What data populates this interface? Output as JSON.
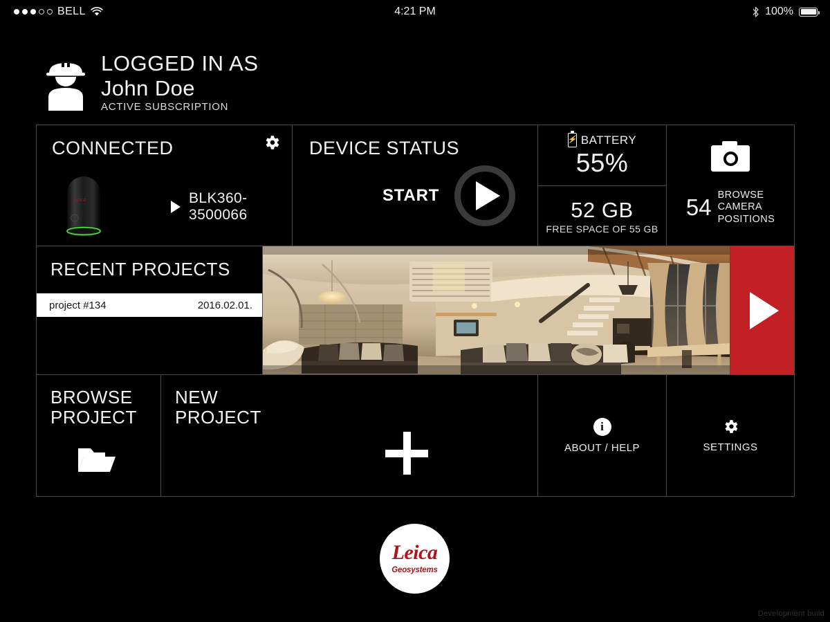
{
  "statusbar": {
    "carrier": "BELL",
    "signal_dots_filled": 3,
    "signal_dots_total": 5,
    "wifi_icon": "wifi-icon",
    "time": "4:21 PM",
    "bluetooth_icon": "bluetooth-icon",
    "battery_percent": "100%",
    "battery_icon": "battery-full-icon"
  },
  "user": {
    "icon": "worker-hardhat-icon",
    "logged_in_label": "LOGGED IN AS",
    "name": "John Doe",
    "subscription": "ACTIVE SUBSCRIPTION"
  },
  "connected": {
    "title": "CONNECTED",
    "gear_icon": "gear-icon",
    "device_icon": "blk360-scanner-image",
    "play_icon": "play-triangle-icon",
    "device_id": "BLK360-3500066"
  },
  "device_status": {
    "title": "DEVICE STATUS",
    "start_label": "START",
    "play_icon": "play-circle-icon"
  },
  "battery_tile": {
    "icon": "battery-charging-icon",
    "label": "BATTERY",
    "value": "55%"
  },
  "storage_tile": {
    "value": "52 GB",
    "sublabel": "FREE SPACE OF 55 GB"
  },
  "camera_positions": {
    "icon": "camera-icon",
    "count": "54",
    "label_line1": "BROWSE",
    "label_line2": "CAMERA",
    "label_line3": "POSITIONS"
  },
  "recent_projects": {
    "title": "RECENT PROJECTS",
    "columns": [
      "name",
      "date"
    ],
    "items": [
      {
        "name": "project #134",
        "date": "2016.02.01."
      }
    ]
  },
  "panorama": {
    "alt": "panoramic-interior-loft-living-room-thumbnail"
  },
  "play_panel": {
    "icon": "play-triangle-icon",
    "color": "#C32026"
  },
  "browse_project": {
    "label_line1": "BROWSE",
    "label_line2": "PROJECT",
    "icon": "open-folder-icon"
  },
  "new_project": {
    "label_line1": "NEW",
    "label_line2": "PROJECT",
    "icon": "plus-icon"
  },
  "about_help": {
    "icon": "info-icon",
    "label": "ABOUT / HELP"
  },
  "settings": {
    "icon": "gear-icon",
    "label": "SETTINGS"
  },
  "brand": {
    "name": "Leica",
    "tagline": "Geosystems",
    "color": "#B4121B"
  },
  "footer": {
    "build_note": "Development build"
  },
  "theme": {
    "background": "#000000",
    "border": "#4A4A4A",
    "text": "#F2F2F2",
    "accent_red": "#C32026"
  }
}
